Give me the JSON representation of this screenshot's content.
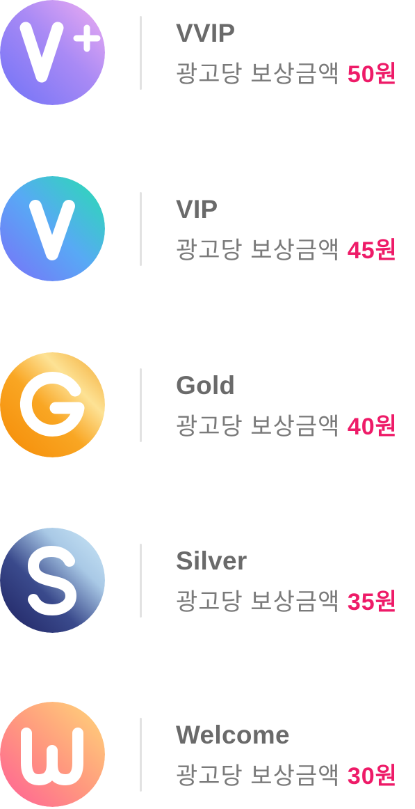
{
  "reward_label": "광고당 보상금액",
  "tiers": [
    {
      "name": "VVIP",
      "amount": "50원",
      "badge_letter": "V+",
      "icon": "vvip-badge-icon",
      "colors": [
        "#7b6cf6",
        "#e9a7f2"
      ]
    },
    {
      "name": "VIP",
      "amount": "45원",
      "badge_letter": "V",
      "icon": "vip-badge-icon",
      "colors": [
        "#6f7bf7",
        "#2fd6b7"
      ]
    },
    {
      "name": "Gold",
      "amount": "40원",
      "badge_letter": "G",
      "icon": "gold-badge-icon",
      "colors": [
        "#f79406",
        "#fbe08a"
      ]
    },
    {
      "name": "Silver",
      "amount": "35원",
      "badge_letter": "S",
      "icon": "silver-badge-icon",
      "colors": [
        "#1f2466",
        "#c9e6f7"
      ]
    },
    {
      "name": "Welcome",
      "amount": "30원",
      "badge_letter": "W",
      "icon": "welcome-badge-icon",
      "colors": [
        "#ff6f94",
        "#ffd27a"
      ]
    }
  ],
  "colors": {
    "amount": "#ee1b68",
    "name": "#6a6a6a",
    "label": "#7a7a7a",
    "divider": "#e2e2e2"
  }
}
